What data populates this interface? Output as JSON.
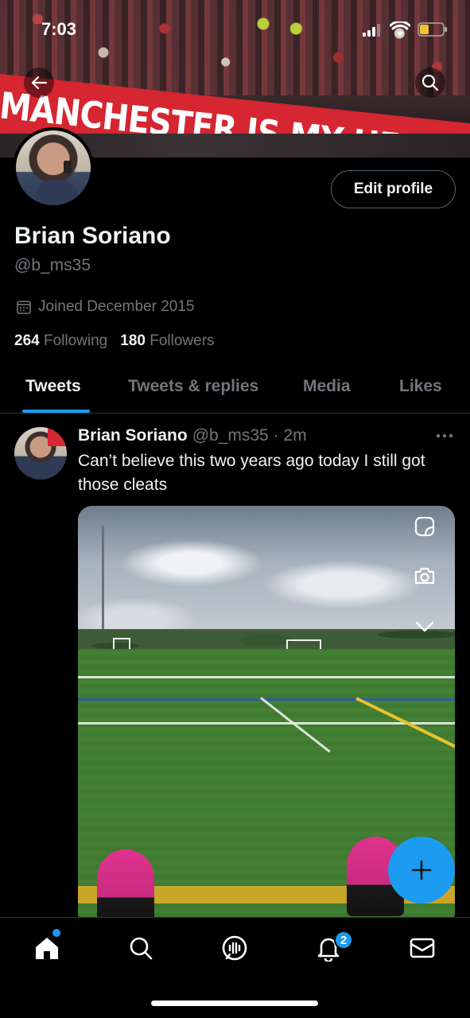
{
  "status_bar": {
    "time": "7:03",
    "icons": [
      "signal-icon",
      "wifi-icon",
      "battery-icon"
    ],
    "battery_color": "#f2c230"
  },
  "banner": {
    "text": "MANCHESTER IS MY HEAVEN",
    "back_icon": "back-arrow-icon",
    "search_icon": "search-icon"
  },
  "profile": {
    "edit_button": "Edit profile",
    "name": "Brian Soriano",
    "handle": "@b_ms35",
    "joined": "Joined December 2015",
    "joined_icon": "calendar-icon",
    "following_count": "264",
    "following_label": "Following",
    "followers_count": "180",
    "followers_label": "Followers"
  },
  "tabs": [
    {
      "label": "Tweets",
      "active": true
    },
    {
      "label": "Tweets & replies",
      "active": false
    },
    {
      "label": "Media",
      "active": false
    },
    {
      "label": "Likes",
      "active": false
    }
  ],
  "tweet": {
    "author": "Brian Soriano",
    "meta": "@b_ms35 · 2m",
    "text": "Can’t believe this two years ago today I still got those cleats",
    "more_icon": "more-horizontal-icon",
    "media_icons": [
      "sticker-icon",
      "camera-rotate-icon",
      "chevron-down-icon"
    ]
  },
  "compose": {
    "icon": "plus-icon"
  },
  "bottom_nav": {
    "items": [
      "home-icon",
      "search-icon",
      "spaces-icon",
      "bell-icon",
      "mail-icon"
    ],
    "notification_badge": "2"
  },
  "colors": {
    "accent": "#1d9bf0",
    "background": "#000000",
    "text_primary": "#eff3f4",
    "text_secondary": "#71767b"
  }
}
